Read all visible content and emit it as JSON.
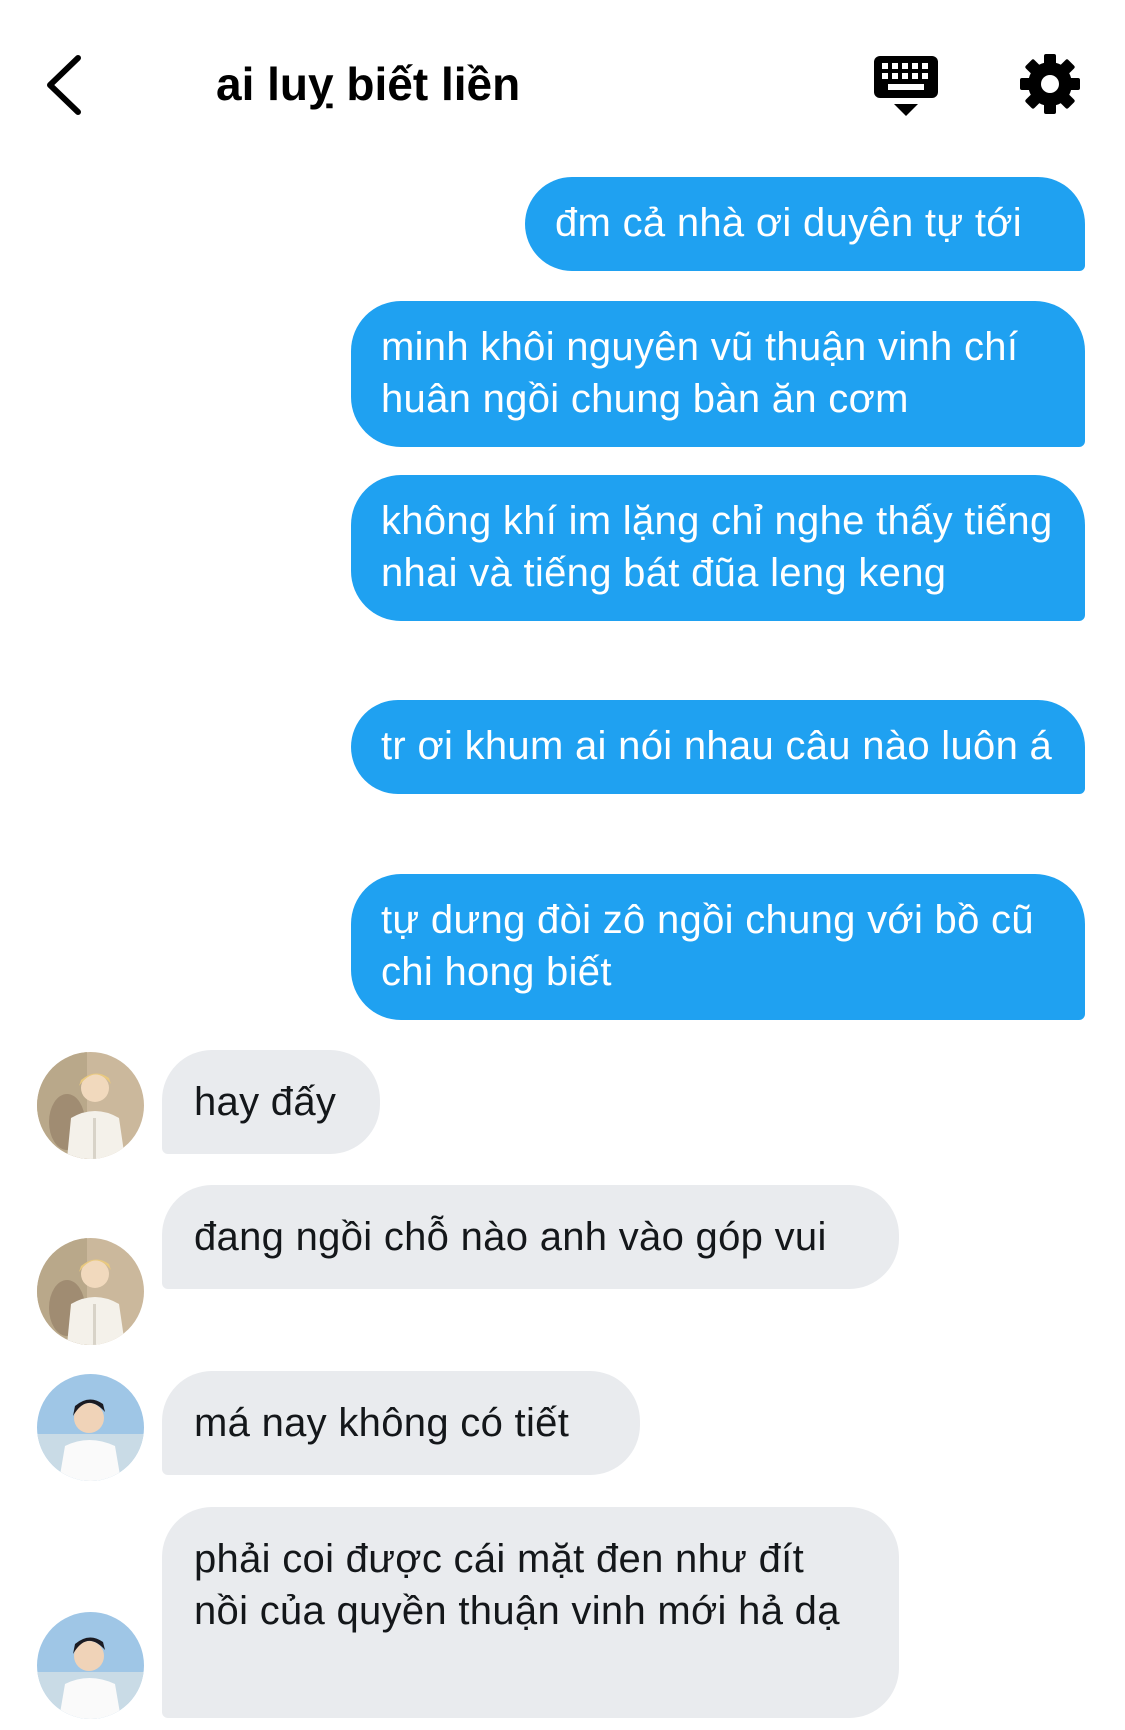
{
  "header": {
    "title": "ai luỵ biết liền",
    "back_icon": "chevron-left-icon",
    "keyboard_icon": "keyboard-icon",
    "settings_icon": "gear-icon"
  },
  "colors": {
    "outgoing_bubble": "#1fa1f1",
    "incoming_bubble": "#e9ebee",
    "icon": "#000000"
  },
  "messages": [
    {
      "direction": "out",
      "text": "đm cả nhà ơi duyên tự tới"
    },
    {
      "direction": "out",
      "text": "minh khôi nguyên vũ thuận vinh chí huân ngồi chung bàn ăn cơm"
    },
    {
      "direction": "out",
      "text": "không khí im lặng chỉ nghe thấy tiếng nhai và tiếng bát đũa leng keng"
    },
    {
      "direction": "out",
      "text": "tr ơi khum ai nói nhau câu nào luôn á"
    },
    {
      "direction": "out",
      "text": "tự dưng đòi zô ngồi chung với bồ cũ chi hong biết"
    },
    {
      "direction": "in",
      "text": "hay đấy",
      "avatar": "avatar-blond"
    },
    {
      "direction": "in",
      "text": "đang ngồi chỗ nào anh vào góp vui",
      "avatar": "avatar-blond"
    },
    {
      "direction": "in",
      "text": "má nay không có tiết",
      "avatar": "avatar-dark-hair"
    },
    {
      "direction": "in",
      "text": "phải coi được cái mặt đen như đít nồi của quyền thuận vinh mới hả dạ",
      "avatar": "avatar-dark-hair"
    }
  ]
}
